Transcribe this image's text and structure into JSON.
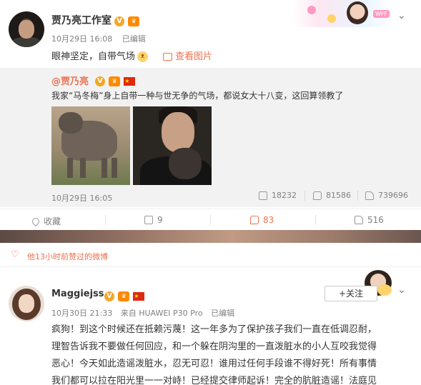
{
  "post1": {
    "author": "贾乃亮工作室",
    "verified_badge": "V",
    "vip_badge": "vip-badge-icon",
    "date": "10月29日 16:08",
    "edited": "已编辑",
    "text": "眼神坚定，自带气场",
    "view_pictures": "查看图片",
    "repost": {
      "author": "@贾乃亮",
      "verified_badge": "V",
      "text": "我家“马冬梅”身上自带一种与世无争的气场，都说女大十八变，这回算领教了",
      "time": "10月29日 16:05",
      "shares": "18232",
      "comments": "81586",
      "likes": "739696"
    },
    "actions": {
      "favorite": "收藏",
      "share": "9",
      "comment": "83",
      "like": "516"
    },
    "banner_tag": "WFF"
  },
  "liked_notice": "他13小时前赞过的微博",
  "post2": {
    "author": "Maggiejss",
    "verified_badge": "V",
    "follow_label": "+关注",
    "date": "10月30日 21:33",
    "source": "来自 HUAWEI P30 Pro",
    "edited": "已编辑",
    "body_lines": [
      "疯狗！到这个时候还在抵赖污蔑！这一年多为了保护孩子我们一直在低调忍耐，",
      "理智告诉我不要做任何回应，和一个躲在阴沟里的一直泼脏水的小人互咬我觉得",
      "恶心！今天如此造谣泼脏水，忍无可忍！谁用过任何手段谁不得好死！所有事情",
      "我们都可以拉在阳光里一一对峙！已经提交律师起诉！完全的肮脏造谣！法庭见"
    ]
  },
  "colors": {
    "accent": "#eb7350",
    "verified": "#f5a623",
    "muted": "#808080"
  }
}
